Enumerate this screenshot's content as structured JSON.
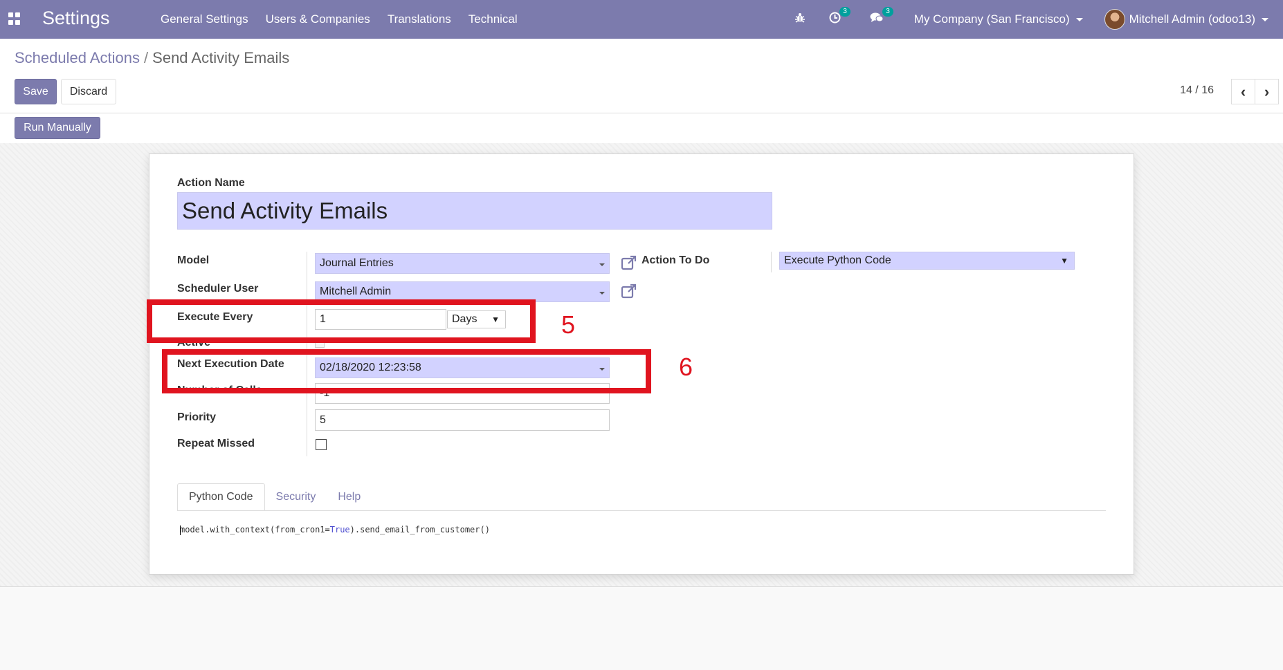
{
  "navbar": {
    "app_title": "Settings",
    "menu": [
      "General Settings",
      "Users & Companies",
      "Translations",
      "Technical"
    ],
    "activity_count": "3",
    "messages_count": "3",
    "company": "My Company (San Francisco)",
    "user": "Mitchell Admin (odoo13)"
  },
  "breadcrumb": {
    "parent": "Scheduled Actions",
    "separator": "/",
    "current": "Send Activity Emails"
  },
  "buttons": {
    "save": "Save",
    "discard": "Discard",
    "run_manually": "Run Manually"
  },
  "pager": {
    "text": "14 / 16"
  },
  "form": {
    "action_name_label": "Action Name",
    "action_name": "Send Activity Emails",
    "model_label": "Model",
    "model": "Journal Entries",
    "scheduler_user_label": "Scheduler User",
    "scheduler_user": "Mitchell Admin",
    "execute_every_label": "Execute Every",
    "interval_number": "1",
    "interval_type": "Days",
    "active_label": "Active",
    "next_execution_label": "Next Execution Date",
    "next_execution": "02/18/2020 12:23:58",
    "number_of_calls_label": "Number of Calls",
    "number_of_calls": "-1",
    "priority_label": "Priority",
    "priority": "5",
    "repeat_missed_label": "Repeat Missed",
    "repeat_missed": false,
    "action_to_do_label": "Action To Do",
    "action_to_do": "Execute Python Code"
  },
  "annotations": {
    "box5": "5",
    "box6": "6"
  },
  "tabs": [
    "Python Code",
    "Security",
    "Help"
  ],
  "code": {
    "prefix": "model.with_context(from_cron1=",
    "keyword": "True",
    "suffix": ").send_email_from_customer()"
  },
  "colors": {
    "brand": "#7c7bad",
    "required_field": "#d2d2ff",
    "annotation": "#e0141f"
  }
}
